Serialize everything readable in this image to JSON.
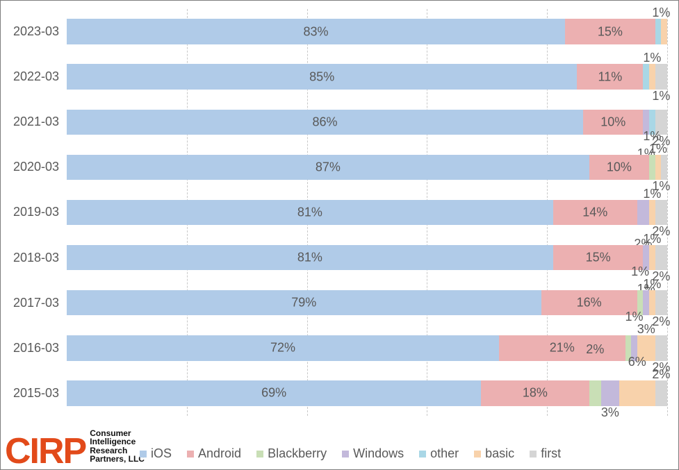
{
  "chart_data": {
    "type": "bar",
    "orientation": "horizontal-stacked",
    "categories": [
      "2023-03",
      "2022-03",
      "2021-03",
      "2020-03",
      "2019-03",
      "2018-03",
      "2017-03",
      "2016-03",
      "2015-03"
    ],
    "series": [
      {
        "name": "iOS",
        "color": "#b0cbe8",
        "values": [
          83,
          85,
          86,
          87,
          81,
          81,
          79,
          72,
          69
        ]
      },
      {
        "name": "Android",
        "color": "#ecb0b1",
        "values": [
          15,
          11,
          10,
          10,
          14,
          15,
          16,
          21,
          18
        ]
      },
      {
        "name": "Blackberry",
        "color": "#c9dfb6",
        "values": [
          0,
          0,
          0,
          1,
          0,
          0,
          1,
          1,
          2
        ]
      },
      {
        "name": "Windows",
        "color": "#c3b9db",
        "values": [
          0,
          0,
          1,
          0,
          2,
          1,
          1,
          1,
          3
        ]
      },
      {
        "name": "other",
        "color": "#a9d7e6",
        "values": [
          1,
          1,
          1,
          0,
          0,
          0,
          0,
          0,
          0
        ]
      },
      {
        "name": "basic",
        "color": "#f8d2ab",
        "values": [
          1,
          1,
          0,
          1,
          1,
          1,
          1,
          3,
          6
        ]
      },
      {
        "name": "first",
        "color": "#d5d5d5",
        "values": [
          0,
          2,
          2,
          1,
          2,
          2,
          2,
          2,
          2
        ]
      }
    ],
    "xlim": [
      0,
      100
    ],
    "x_ticks": [
      0,
      20,
      40,
      60,
      80,
      100
    ],
    "data_labels": {
      "2023-03": {
        "iOS": "83%",
        "Android": "15%",
        "basic": "1%"
      },
      "2022-03": {
        "iOS": "85%",
        "Android": "11%",
        "basic": "1%",
        "first": "1%"
      },
      "2021-03": {
        "iOS": "86%",
        "Android": "10%",
        "Windows": "1%",
        "first": "2%"
      },
      "2020-03": {
        "iOS": "87%",
        "Android": "10%",
        "Blackberry": "1%",
        "basic": "1%",
        "first": "1%"
      },
      "2019-03": {
        "iOS": "81%",
        "Android": "14%",
        "Windows": "2%",
        "basic": "1%",
        "first": "2%"
      },
      "2018-03": {
        "iOS": "81%",
        "Android": "15%",
        "Windows": "1%",
        "basic": "1%",
        "first": "2%"
      },
      "2017-03": {
        "iOS": "79%",
        "Android": "16%",
        "Blackberry": "1%",
        "basic": "1%",
        "first": "2%"
      },
      "2016-03": {
        "iOS": "72%",
        "Android": "21%",
        "basic": "3%",
        "Windows": "1%",
        "first": "2%"
      },
      "2015-03": {
        "iOS": "69%",
        "Android": "18%",
        "Blackberry": "2%",
        "Windows": "3%",
        "basic": "6%",
        "first": "2%"
      }
    }
  },
  "legend": {
    "items": [
      "iOS",
      "Android",
      "Blackberry",
      "Windows",
      "other",
      "basic",
      "first"
    ]
  },
  "branding": {
    "mark": "CIRP",
    "line1": "Consumer",
    "line2": "Intelligence",
    "line3": "Research",
    "line4": "Partners, LLC"
  }
}
